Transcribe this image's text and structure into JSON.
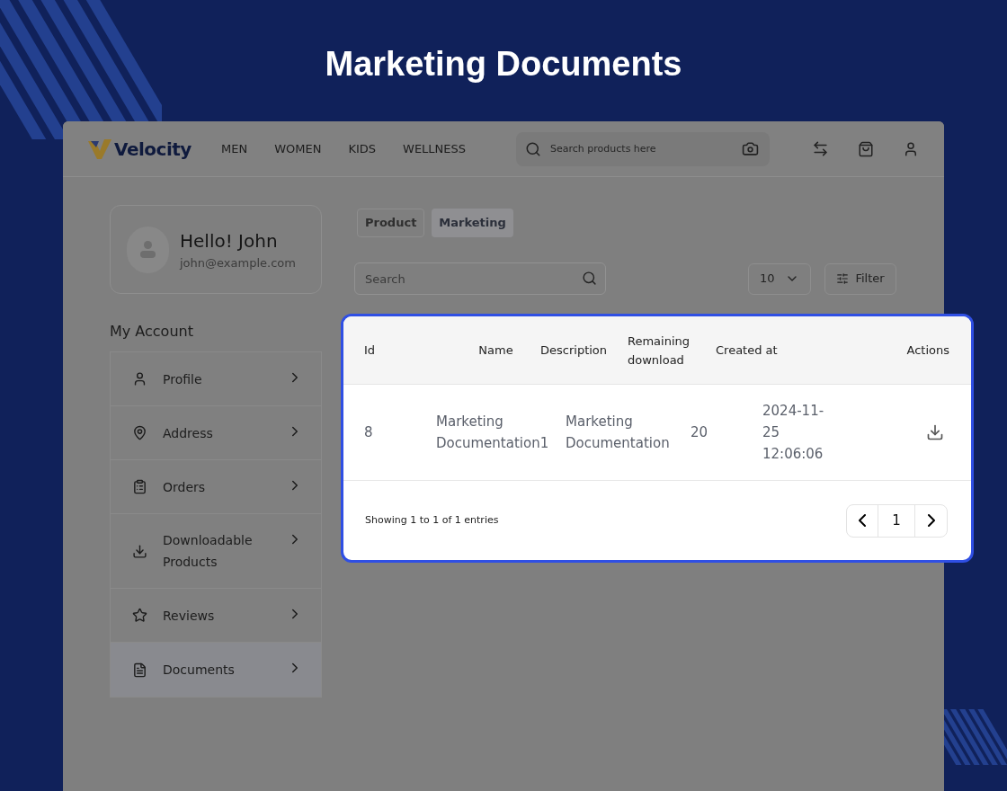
{
  "title": "Marketing Documents",
  "header": {
    "logo": "Velocity",
    "nav": [
      "MEN",
      "WOMEN",
      "KIDS",
      "WELLNESS"
    ],
    "search": {
      "placeholder": "Search products here"
    }
  },
  "profile": {
    "greeting": "Hello! John",
    "email": "john@example.com"
  },
  "account": {
    "heading": "My Account",
    "items": [
      {
        "label": "Profile",
        "selected": false
      },
      {
        "label": "Address",
        "selected": false
      },
      {
        "label": "Orders",
        "selected": false
      },
      {
        "label": "Downloadable Products",
        "selected": false
      },
      {
        "label": "Reviews",
        "selected": false
      },
      {
        "label": "Documents",
        "selected": true
      }
    ]
  },
  "tabs": [
    {
      "label": "Product",
      "selected": false
    },
    {
      "label": "Marketing",
      "selected": true
    }
  ],
  "search": {
    "placeholder": "Search"
  },
  "page_size": "10",
  "filter": "Filter",
  "table": {
    "columns": [
      "Id",
      "Name",
      "Description",
      "Remaining download",
      "Created at",
      "Actions"
    ],
    "rows": [
      {
        "id": "8",
        "name": "Marketing Documentation1",
        "description": "Marketing Documentation",
        "remaining": "20",
        "created": "2024-11-25 12:06:06"
      }
    ]
  },
  "footer": {
    "summary": "Showing 1 to 1 of 1 entries",
    "pages": [
      {
        "label": "1",
        "selected": true
      }
    ]
  }
}
